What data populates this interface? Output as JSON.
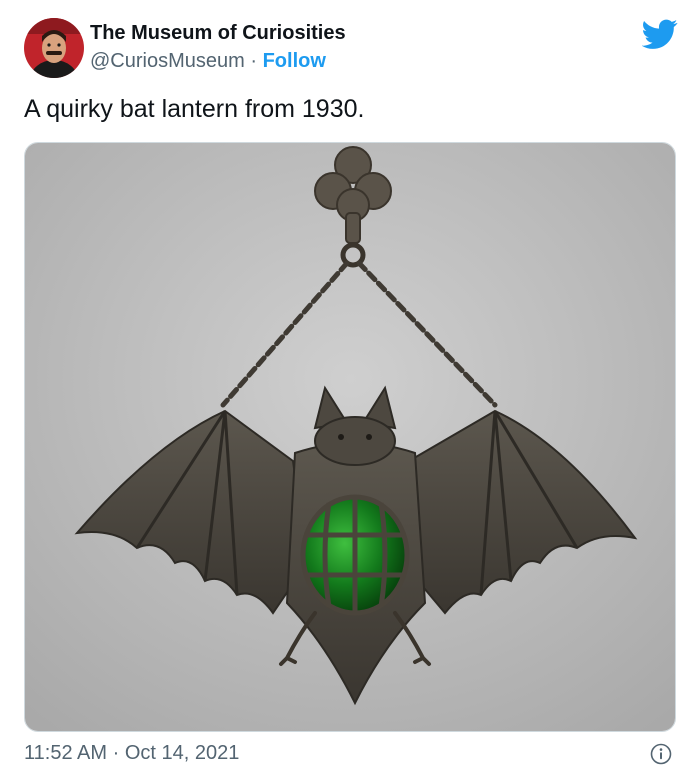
{
  "author": {
    "display_name": "The Museum of Curiosities",
    "handle": "@CuriosMuseum",
    "separator": " · ",
    "follow_label": "Follow"
  },
  "tweet": {
    "text": "A quirky bat lantern from 1930.",
    "time": "11:52 AM",
    "date": "Oct 14, 2021",
    "time_separator": " · "
  },
  "icons": {
    "brand": "twitter-bird-icon",
    "info": "info-icon"
  },
  "colors": {
    "accent": "#1d9bf0",
    "secondary_text": "#536471"
  }
}
